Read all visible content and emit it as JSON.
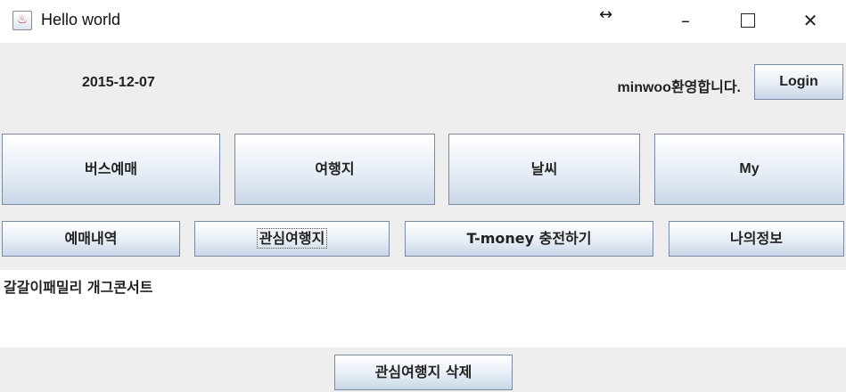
{
  "window": {
    "title": "Hello world",
    "app_icon": "java-cup-icon"
  },
  "header": {
    "date": "2015-12-07",
    "welcome": "minwoo환영합니다.",
    "login_label": "Login"
  },
  "main_menu": [
    {
      "label": "버스예매"
    },
    {
      "label": "여행지"
    },
    {
      "label": "날씨"
    },
    {
      "label": "My"
    }
  ],
  "sub_menu": [
    {
      "label": "예매내역"
    },
    {
      "label": "관심여행지"
    },
    {
      "label": "T-money 충전하기"
    },
    {
      "label": "나의정보"
    }
  ],
  "content": {
    "text": "갈갈이패밀리 개그콘서트"
  },
  "footer": {
    "delete_label": "관심여행지 삭제"
  }
}
